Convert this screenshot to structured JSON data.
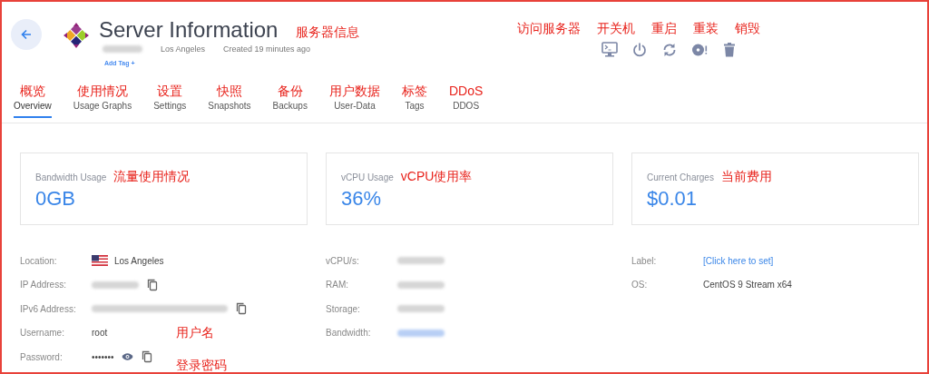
{
  "header": {
    "title": "Server Information",
    "title_note": "服务器信息",
    "subtitle": [
      {
        "kind": "redacted"
      },
      {
        "kind": "text",
        "text": "Los Angeles"
      },
      {
        "kind": "text",
        "text": "Created 19 minutes ago"
      }
    ],
    "add_tag": "Add Tag +",
    "action_notes": [
      "访问服务器",
      "开关机",
      "重启",
      "重装",
      "销毁"
    ],
    "actions": [
      {
        "kind": "console"
      },
      {
        "kind": "power"
      },
      {
        "kind": "restart"
      },
      {
        "kind": "reinstall"
      },
      {
        "kind": "destroy"
      }
    ]
  },
  "tabs": [
    {
      "label": "Overview",
      "note": "概览",
      "selected": true
    },
    {
      "label": "Usage Graphs",
      "note": "使用情况",
      "selected": false
    },
    {
      "label": "Settings",
      "note": "设置",
      "selected": false
    },
    {
      "label": "Snapshots",
      "note": "快照",
      "selected": false
    },
    {
      "label": "Backups",
      "note": "备份",
      "selected": false
    },
    {
      "label": "User-Data",
      "note": "用户数据",
      "selected": false
    },
    {
      "label": "Tags",
      "note": "标签",
      "selected": false
    },
    {
      "label": "DDOS",
      "note": "DDoS",
      "selected": false
    }
  ],
  "stats": [
    {
      "label": "Bandwidth Usage",
      "note": "流量使用情况",
      "value": "0GB"
    },
    {
      "label": "vCPU Usage",
      "note": "vCPU使用率",
      "value": "36%"
    },
    {
      "label": "Current Charges",
      "note": "当前费用",
      "value": "$0.01"
    }
  ],
  "details": [
    [
      {
        "label": "Location:",
        "kind": "flag",
        "value": "Los Angeles"
      },
      {
        "label": "IP Address:",
        "kind": "redacted",
        "copy": true
      },
      {
        "label": "IPv6 Address:",
        "kind": "redactedlong",
        "copy": true
      },
      {
        "label": "Username:",
        "kind": "text",
        "value": "root",
        "note": "用户名"
      },
      {
        "label": "Password:",
        "kind": "text",
        "value": "•••••••",
        "reveal": true,
        "copy": true,
        "note": "登录密码"
      }
    ],
    [
      {
        "label": "vCPU/s:",
        "kind": "redacted"
      },
      {
        "label": "RAM:",
        "kind": "redacted"
      },
      {
        "label": "Storage:",
        "kind": "redacted"
      },
      {
        "label": "Bandwidth:",
        "kind": "redacted",
        "link": true
      }
    ],
    [
      {
        "label": "Label:",
        "kind": "link",
        "value": "[Click here to set]"
      },
      {
        "label": "OS:",
        "kind": "text",
        "value": "CentOS 9 Stream x64"
      }
    ]
  ]
}
